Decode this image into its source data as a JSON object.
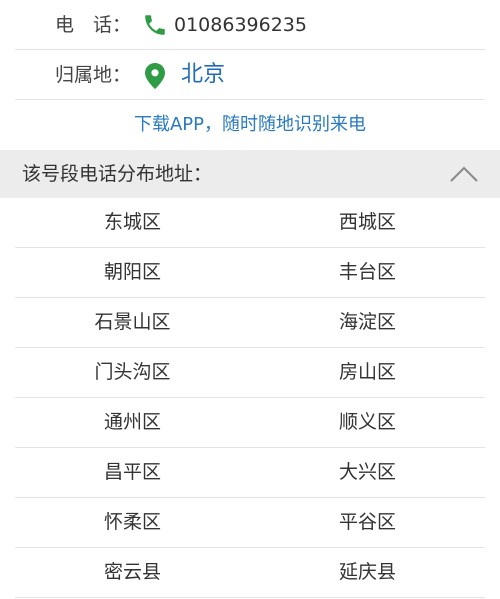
{
  "phone": {
    "label": "电　话：",
    "number": "01086396235",
    "icon": "phone-icon",
    "icon_color": "#2e9b45"
  },
  "home": {
    "label": "归属地：",
    "location": "北京",
    "icon": "map-pin-icon",
    "icon_color": "#2e9b45",
    "location_color": "#1f6db6"
  },
  "download_link": "下载APP，随时随地识别来电",
  "distribution": {
    "title": "该号段电话分布地址：",
    "expanded": true,
    "districts": [
      [
        "东城区",
        "西城区"
      ],
      [
        "朝阳区",
        "丰台区"
      ],
      [
        "石景山区",
        "海淀区"
      ],
      [
        "门头沟区",
        "房山区"
      ],
      [
        "通州区",
        "顺义区"
      ],
      [
        "昌平区",
        "大兴区"
      ],
      [
        "怀柔区",
        "平谷区"
      ],
      [
        "密云县",
        "延庆县"
      ]
    ]
  }
}
